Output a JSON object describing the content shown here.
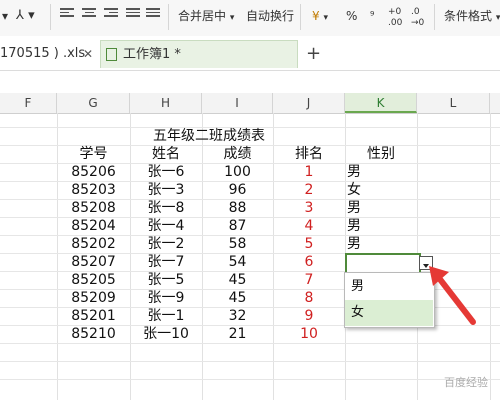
{
  "ribbon": {
    "merge_center": "合并居中",
    "wrap_text": "自动换行",
    "percent": "%",
    "comma": "⁹",
    "inc_decimal": ".00",
    "dec_decimal": ".0",
    "conditional_format": "条件格式"
  },
  "tabs": {
    "file1": "170515 ) .xls",
    "file2": "工作簿1 *",
    "close": "✕",
    "add": "+"
  },
  "columns": [
    "F",
    "G",
    "H",
    "I",
    "J",
    "K",
    "L"
  ],
  "selected_column": "K",
  "sheet": {
    "title": "五年级二班成绩表",
    "headers": {
      "id": "学号",
      "name": "姓名",
      "score": "成绩",
      "rank": "排名",
      "gender": "性别"
    },
    "rows": [
      {
        "id": "85206",
        "name": "张一6",
        "score": "100",
        "rank": "1",
        "gender": "男"
      },
      {
        "id": "85203",
        "name": "张一3",
        "score": "96",
        "rank": "2",
        "gender": "女"
      },
      {
        "id": "85208",
        "name": "张一8",
        "score": "88",
        "rank": "3",
        "gender": "男"
      },
      {
        "id": "85204",
        "name": "张一4",
        "score": "87",
        "rank": "4",
        "gender": "男"
      },
      {
        "id": "85202",
        "name": "张一2",
        "score": "58",
        "rank": "5",
        "gender": "男"
      },
      {
        "id": "85207",
        "name": "张一7",
        "score": "54",
        "rank": "6",
        "gender": ""
      },
      {
        "id": "85205",
        "name": "张一5",
        "score": "45",
        "rank": "7",
        "gender": ""
      },
      {
        "id": "85209",
        "name": "张一9",
        "score": "45",
        "rank": "8",
        "gender": ""
      },
      {
        "id": "85201",
        "name": "张一1",
        "score": "32",
        "rank": "9",
        "gender": ""
      },
      {
        "id": "85210",
        "name": "张一10",
        "score": "21",
        "rank": "10",
        "gender": ""
      }
    ]
  },
  "dropdown": {
    "options": [
      "男",
      "女"
    ],
    "highlighted": "女"
  },
  "watermark": "百度经验",
  "colors": {
    "accent": "#4f8a3a",
    "rank_red": "#d02020",
    "arrow_red": "#e53935"
  }
}
